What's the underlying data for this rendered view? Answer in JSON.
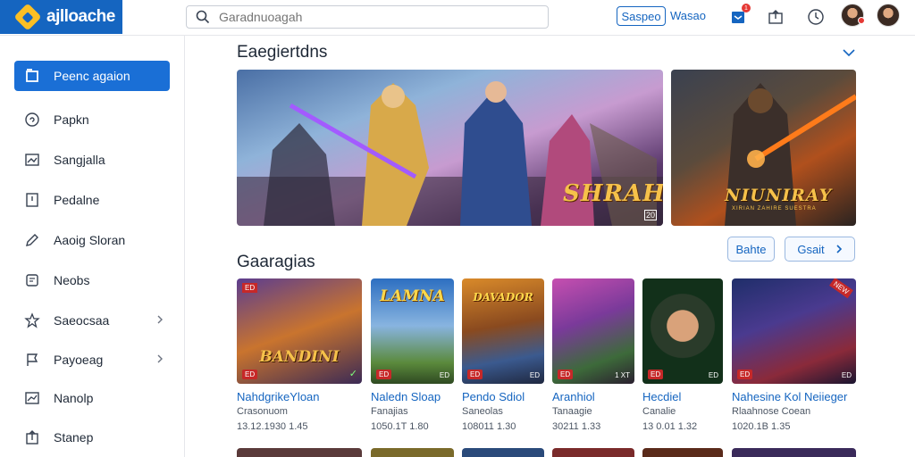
{
  "header": {
    "logo_text": "ajlloache",
    "search_placeholder": "Garadnuoagah",
    "primary_button": "Saspeo",
    "link_label": "Wasao",
    "notification_count": "1",
    "colors": {
      "brand": "#1565c0",
      "accent": "#1a6fd6"
    }
  },
  "sidebar": {
    "items": [
      {
        "label": "Peenc agaion",
        "icon": "square-icon",
        "active": true
      },
      {
        "label": "Papkn",
        "icon": "search-circle-icon"
      },
      {
        "label": "Sangjalla",
        "icon": "image-icon"
      },
      {
        "label": "Pedalne",
        "icon": "document-icon"
      },
      {
        "label": "Aaoig Sloran",
        "icon": "pencil-icon"
      },
      {
        "label": "Neobs",
        "icon": "notes-icon"
      },
      {
        "label": "Saeocsaa",
        "icon": "star-icon",
        "chevron": true
      },
      {
        "label": "Payoeag",
        "icon": "flag-icon",
        "chevron": true
      },
      {
        "label": "Nanolp",
        "icon": "chart-icon"
      },
      {
        "label": "Stanep",
        "icon": "upload-icon"
      }
    ]
  },
  "featured": {
    "title": "Eaegiertdns",
    "banners": [
      {
        "title": "SHRAHIH",
        "badge": "20"
      },
      {
        "title": "NIUNIRAY",
        "subtitle": "XIRIAN ZAHIRE SUESTRA"
      }
    ]
  },
  "games": {
    "title": "Gaaragias",
    "buttons": {
      "left": "Bahte",
      "right": "Gsait"
    },
    "cards": [
      {
        "name": "NahdgrikeYloan",
        "sub": "Crasonuom",
        "meta": "13.12.1930 1.45",
        "art": "BANDINI",
        "tag": "ED",
        "rating": "ED",
        "corner": "✓"
      },
      {
        "name": "Naledn Sloap",
        "sub": "Fanajias",
        "meta": "1050.1T 1.80",
        "art": "LAMNA",
        "rating": "ED",
        "corner": "ED"
      },
      {
        "name": "Pendo Sdiol",
        "sub": "Saneolas",
        "meta": "108011 1.30",
        "art": "DAVADOR",
        "rating": "ED",
        "corner": "ED"
      },
      {
        "name": "Aranhiol",
        "sub": "Tanaagie",
        "meta": "30211 1.33",
        "art": "",
        "rating": "ED",
        "corner": "1 XT"
      },
      {
        "name": "Hecdiel",
        "sub": "Canalie",
        "meta": "13 0.01 1.32",
        "art": "",
        "rating": "ED",
        "corner": "ED"
      },
      {
        "name": "Nahesine Kol Neiieger",
        "sub": "Rlaahnose Coean",
        "meta": "1020.1B 1.35",
        "art": "",
        "rating": "ED",
        "corner": "ED",
        "tag": "NEW"
      }
    ]
  }
}
